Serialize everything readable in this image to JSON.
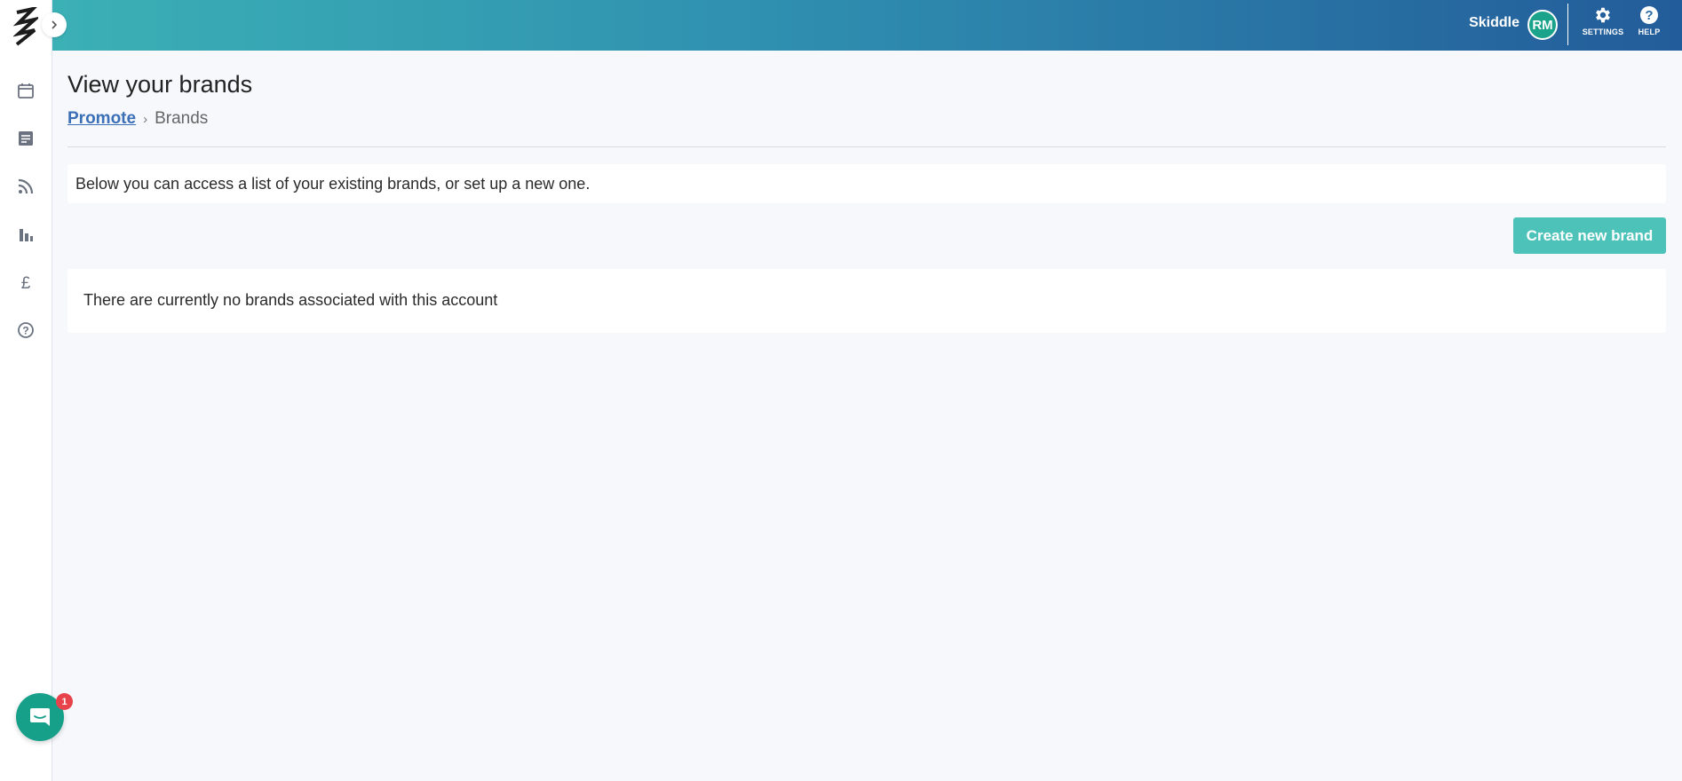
{
  "header": {
    "account_name": "Skiddle",
    "avatar_initials": "RM",
    "settings_label": "SETTINGS",
    "help_label": "HELP",
    "gradient_colors": [
      "#3bb0b5",
      "#235c9a"
    ]
  },
  "sidebar": {
    "icons": [
      "calendar-icon",
      "document-icon",
      "rss-icon",
      "bar-chart-icon",
      "pound-icon",
      "help-circle-icon"
    ]
  },
  "main": {
    "title": "View your brands",
    "breadcrumb": {
      "parent": "Promote",
      "separator": "›",
      "current": "Brands"
    },
    "intro_text": "Below you can access a list of your existing brands, or set up a new one.",
    "create_button_label": "Create new brand",
    "empty_message": "There are currently no brands associated with this account"
  },
  "chat": {
    "badge_count": "1"
  },
  "colors": {
    "accent": "#4cc2b8",
    "link": "#3b6fb6",
    "avatar": "#1aa38a",
    "badge": "#e8434b"
  }
}
